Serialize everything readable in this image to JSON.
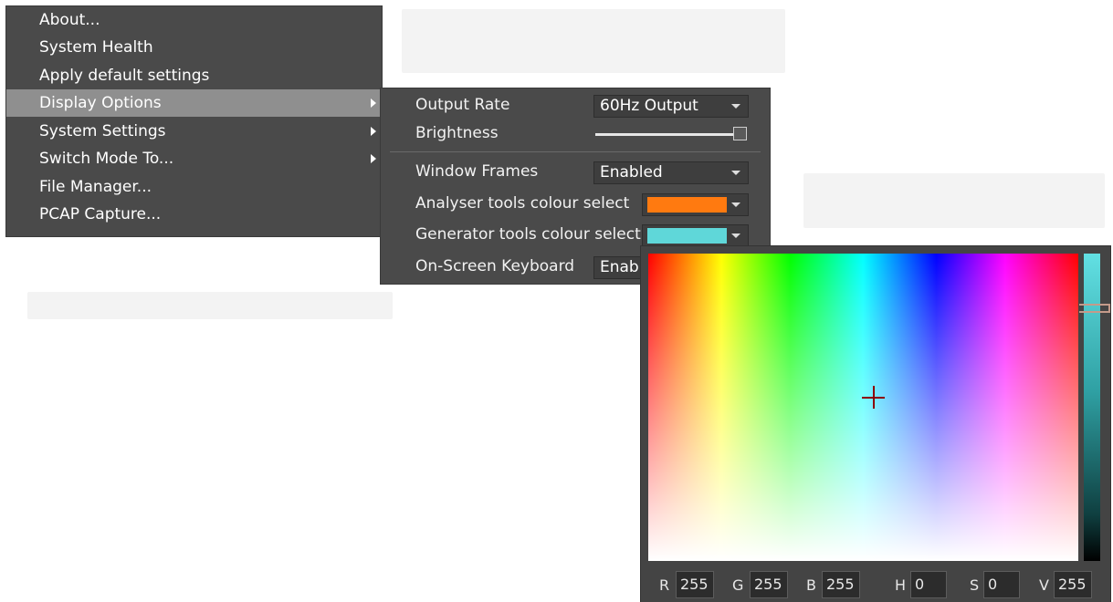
{
  "main_menu": {
    "items": [
      {
        "label": "About...",
        "submenu": false
      },
      {
        "label": "System Health",
        "submenu": false
      },
      {
        "label": "Apply default settings",
        "submenu": false
      },
      {
        "label": "Display Options",
        "submenu": true,
        "active": true
      },
      {
        "label": "System Settings",
        "submenu": true
      },
      {
        "label": "Switch Mode To...",
        "submenu": true
      },
      {
        "label": "File Manager...",
        "submenu": false
      },
      {
        "label": "PCAP Capture...",
        "submenu": false
      }
    ]
  },
  "display_options": {
    "output_rate": {
      "label": "Output Rate",
      "value": "60Hz Output"
    },
    "brightness": {
      "label": "Brightness",
      "level": 1.0
    },
    "window_frames": {
      "label": "Window Frames",
      "value": "Enabled"
    },
    "analyser_colour": {
      "label": "Analyser tools colour select",
      "color": "#ff7a10"
    },
    "generator_colour": {
      "label": "Generator tools colour select",
      "color": "#5fd7d9"
    },
    "onscreen_keyboard": {
      "label": "On-Screen Keyboard",
      "value": "Enabl"
    }
  },
  "color_picker": {
    "fields": {
      "r_label": "R",
      "r_value": "255",
      "g_label": "G",
      "g_value": "255",
      "b_label": "B",
      "b_value": "255",
      "h_label": "H",
      "h_value": "0",
      "s_label": "S",
      "s_value": "0",
      "v_label": "V",
      "v_value": "255"
    }
  },
  "colors": {
    "menu_bg": "#4a4a4a",
    "menu_active": "#8f8f8f",
    "crosshair": "#8b0000"
  }
}
